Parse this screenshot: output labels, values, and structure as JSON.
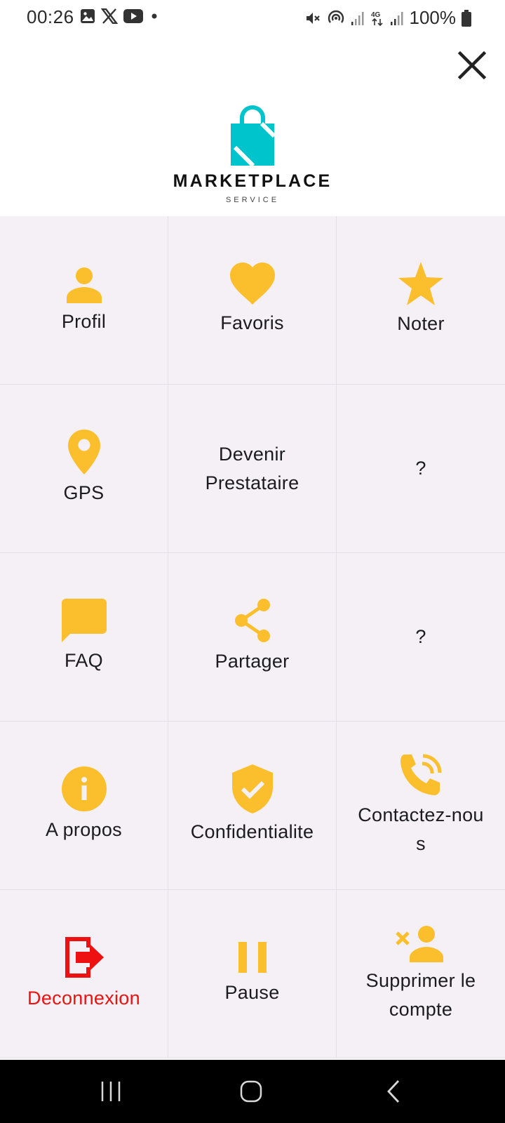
{
  "status_bar": {
    "time": "00:26",
    "battery": "100%",
    "left_icons": [
      "gallery-icon",
      "x-logo-icon",
      "youtube-icon",
      "dot-icon"
    ],
    "right_icons": [
      "mute-icon",
      "hotspot-icon",
      "signal-icon",
      "4g-icon",
      "signal-icon",
      "battery-icon"
    ]
  },
  "logo": {
    "title": "MARKETPLACE",
    "subtitle": "SERVICE",
    "bag_color": "#00c4cc"
  },
  "menu": {
    "items": [
      {
        "label": "Profil",
        "icon": "person-icon"
      },
      {
        "label": "Favoris",
        "icon": "heart-icon"
      },
      {
        "label": "Noter",
        "icon": "star-icon"
      },
      {
        "label": "GPS",
        "icon": "location-pin-icon"
      },
      {
        "label": "Devenir Prestataire",
        "icon": ""
      },
      {
        "label": "?",
        "icon": ""
      },
      {
        "label": "FAQ",
        "icon": "chat-bubble-icon"
      },
      {
        "label": "Partager",
        "icon": "share-icon"
      },
      {
        "label": "?",
        "icon": ""
      },
      {
        "label": "A propos",
        "icon": "info-icon"
      },
      {
        "label": "Confidentialite",
        "icon": "shield-check-icon"
      },
      {
        "label": "Contactez-nous",
        "icon": "phone-call-icon"
      },
      {
        "label": "Deconnexion",
        "icon": "logout-icon"
      },
      {
        "label": "Pause",
        "icon": "pause-icon"
      },
      {
        "label": "Supprimer le compte",
        "icon": "remove-user-icon"
      }
    ]
  },
  "colors": {
    "accent": "#fbbf2d",
    "danger": "#ee1111",
    "grid_bg": "#f5f0f5",
    "divider": "#e4dfe6"
  },
  "nav": {
    "buttons": [
      "recents-icon",
      "home-icon",
      "back-icon"
    ]
  }
}
